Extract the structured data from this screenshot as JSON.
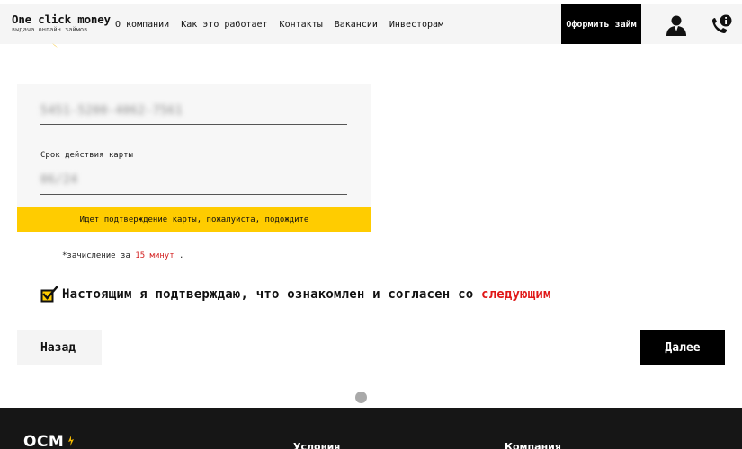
{
  "header": {
    "brand_name": "One click money",
    "brand_tagline": "выдача онлайн займов",
    "nav": [
      {
        "label": "О компании"
      },
      {
        "label": "Как это работает"
      },
      {
        "label": "Контакты"
      },
      {
        "label": "Вакансии"
      },
      {
        "label": "Инвесторам"
      }
    ],
    "cta_label": "Оформить займ",
    "icons": [
      "user-icon",
      "phone-info-icon"
    ]
  },
  "card_form": {
    "card_number_value": "5451-5200-4062-7561",
    "expiry_label": "Срок действия карты",
    "expiry_value": "06/24",
    "status_message": "Идет подтверждение карты, пожалуйста, подождите"
  },
  "credit_note": {
    "prefix": "*зачисление за ",
    "highlight": "15 минут",
    "suffix": " ."
  },
  "consent": {
    "checked": true,
    "text": "Настоящим я подтверждаю, что ознакомлен и согласен со ",
    "link_text": "следующим"
  },
  "buttons": {
    "back_label": "Назад",
    "next_label": "Далее"
  },
  "footer": {
    "logo": "OCM",
    "columns": [
      "Условия",
      "Компания"
    ]
  },
  "colors": {
    "accent_yellow": "#ffcc00",
    "link_red": "#e01818",
    "dark": "#000000"
  }
}
